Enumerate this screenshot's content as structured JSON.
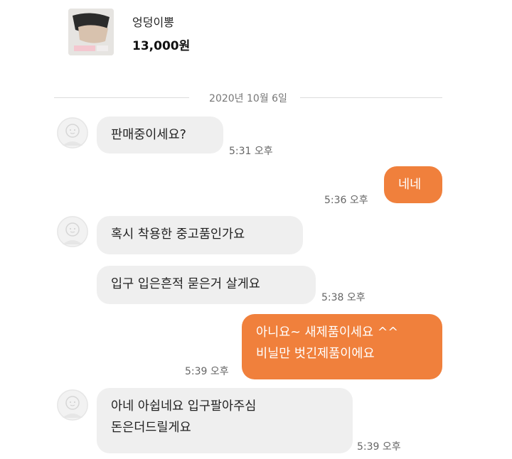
{
  "product": {
    "name": "엉덩이뽕",
    "price": "13,000원"
  },
  "chat": {
    "date": "2020년 10월 6일",
    "messages": [
      {
        "from": "buyer",
        "text": "판매중이세요?",
        "time": "5:31 오후"
      },
      {
        "from": "seller",
        "text": "네네",
        "time": "5:36 오후"
      },
      {
        "from": "buyer",
        "text": "혹시 착용한 중고품인가요",
        "time": ""
      },
      {
        "from": "buyer",
        "text": "입구 입은흔적 묻은거 살게요",
        "time": "5:38 오후"
      },
      {
        "from": "seller",
        "text": "아니요~ 새제품이세요 ^^\n비닐만 벗긴제품이에요",
        "time": "5:39 오후"
      },
      {
        "from": "buyer",
        "text": "아네 아쉽네요 입구팔아주심\n돈은더드릴게요",
        "time": "5:39 오후"
      }
    ]
  },
  "colors": {
    "outgoing_bubble": "#f0803c",
    "incoming_bubble": "#efefef"
  },
  "icons": {
    "avatar": "default-user-avatar-icon"
  }
}
